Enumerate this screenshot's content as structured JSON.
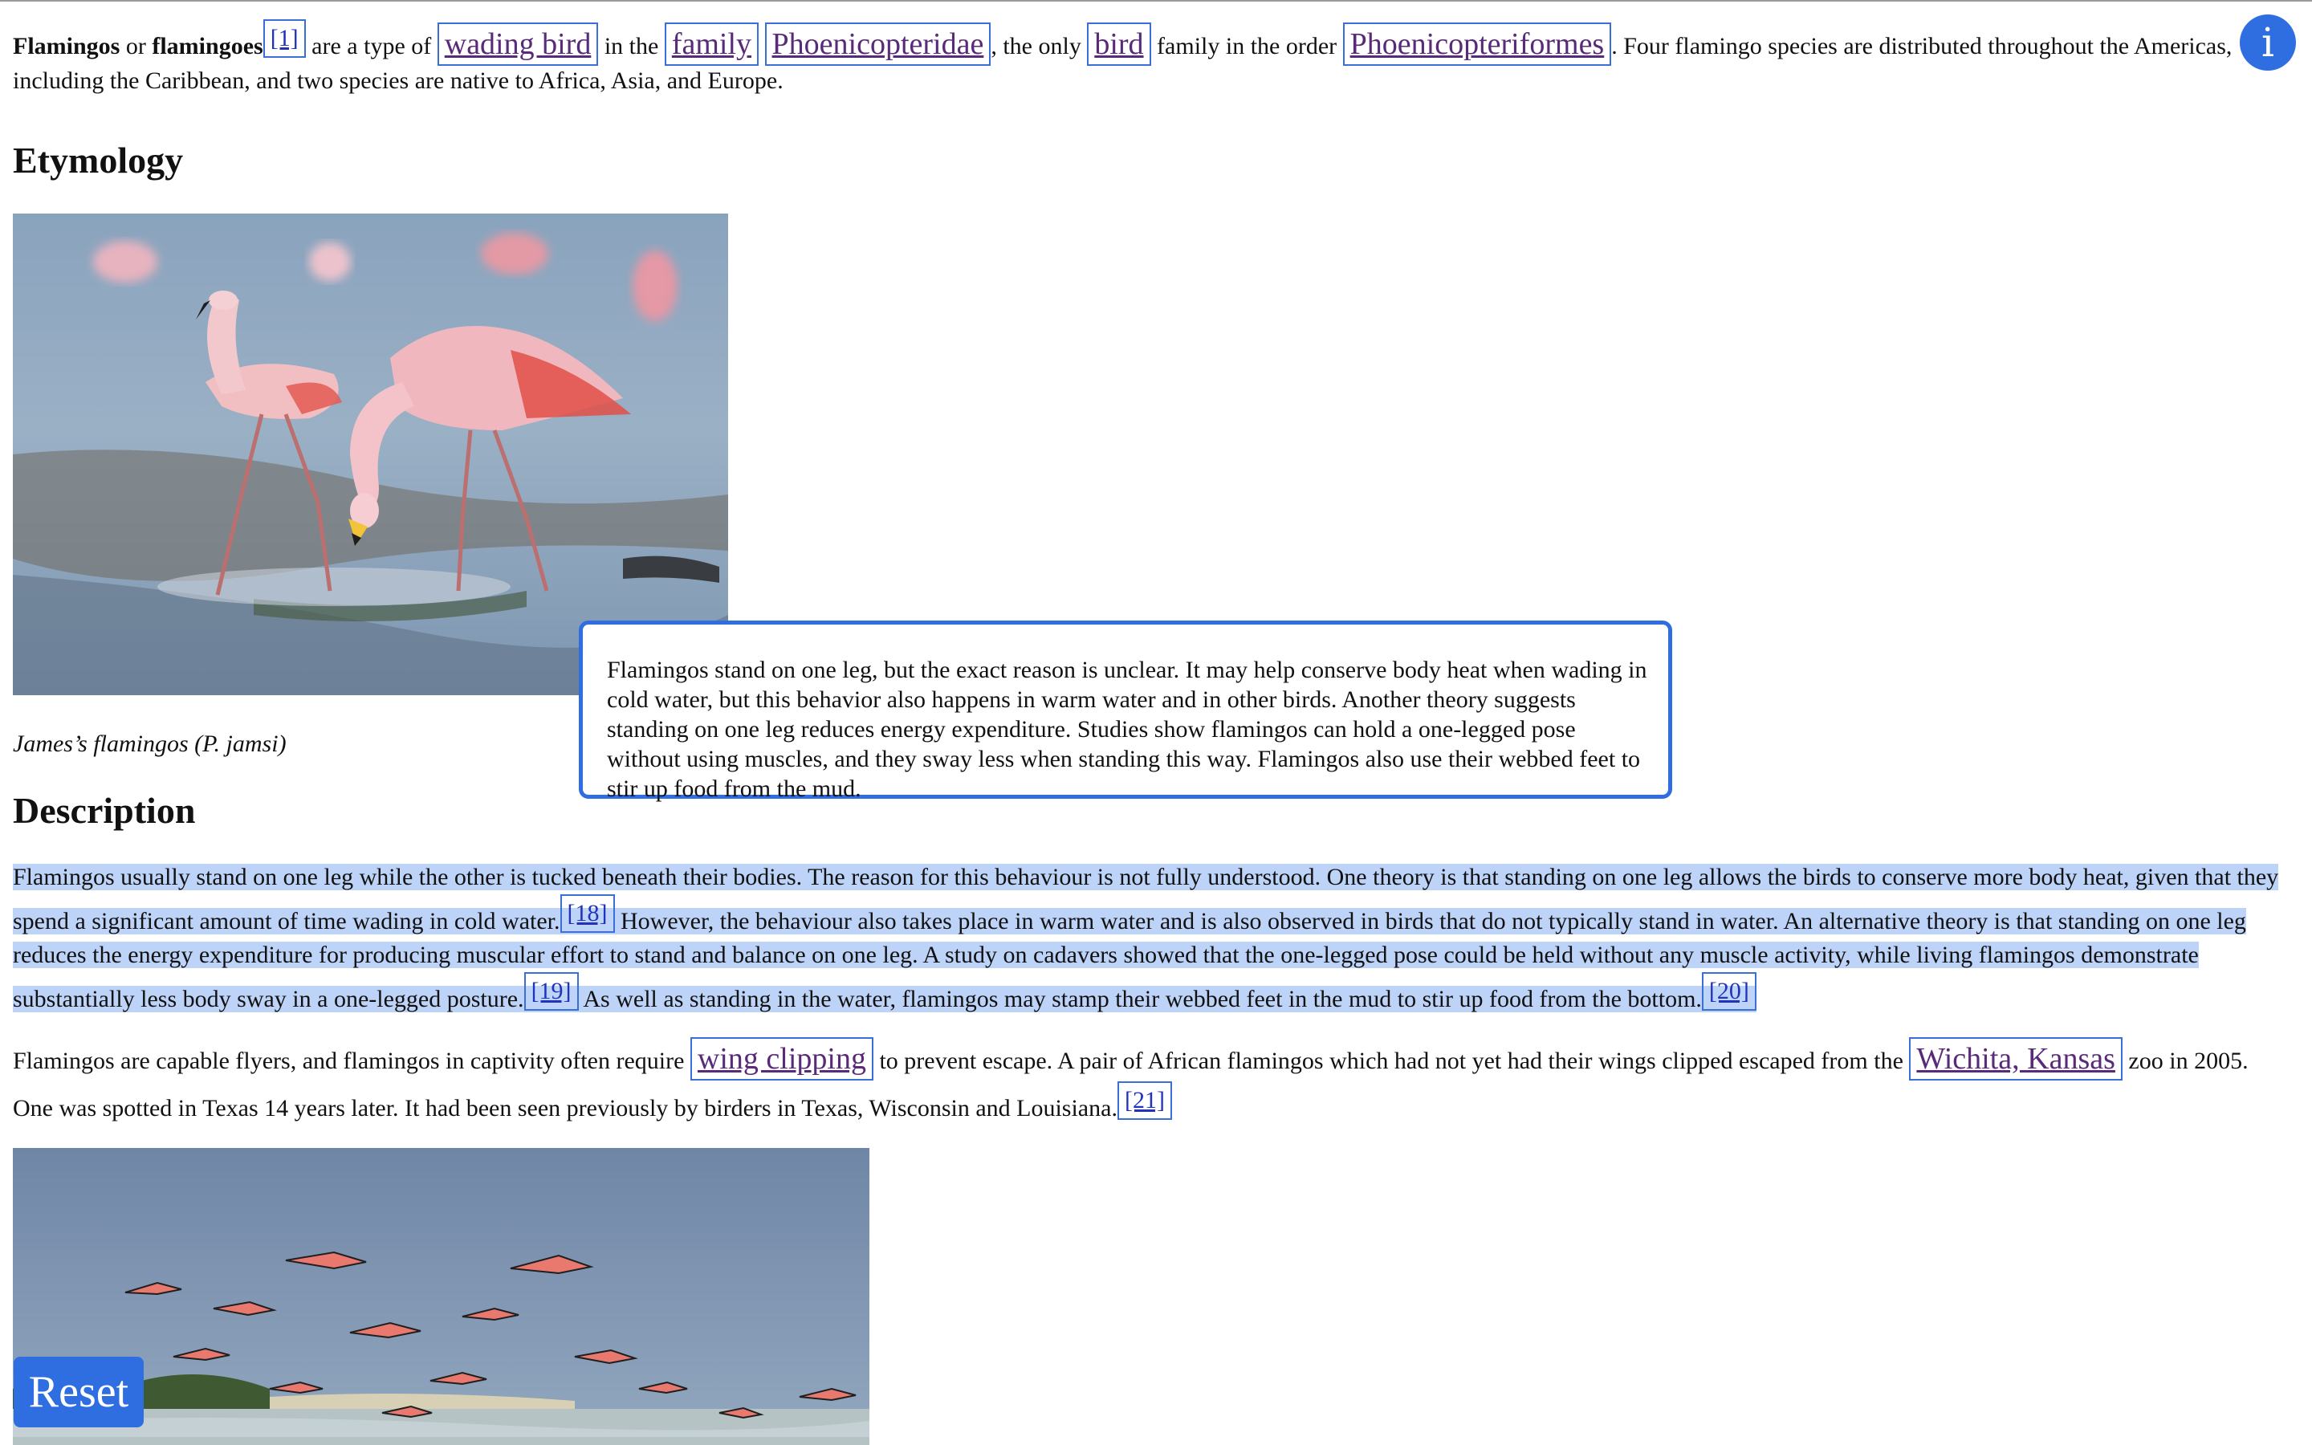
{
  "intro": {
    "term1": "Flamingos",
    "or": " or ",
    "term2": "flamingoes",
    "cite1": "[1]",
    "t1": " are a type of ",
    "link_wading_bird": "wading bird",
    "t2": " in the ",
    "link_family": "family",
    "link_phoenicopteridae": "Phoenicopteridae",
    "t3": ", the only ",
    "link_bird": "bird",
    "t4": " family in the order ",
    "link_phoenicopteriformes": "Phoenicopteriformes",
    "t5": ". Four flamingo species are distributed throughout the Americas, including the Caribbean, and two species are native to Africa, Asia, and Europe."
  },
  "etymology": {
    "heading": "Etymology",
    "caption": "James’s flamingos (P. jamsi)"
  },
  "description": {
    "heading": "Description",
    "p1_a": "Flamingos usually stand on one leg while the other is tucked beneath their bodies. The reason for this behaviour is not fully understood. One theory is that standing on one leg allows the birds to conserve more body heat, given that they spend a significant amount of time wading in cold water.",
    "cite18": "[18]",
    "p1_b": " However, the behaviour also takes place in warm water and is also observed in birds that do not typically stand in water. An alternative theory is that standing on one leg reduces the energy expenditure for producing muscular effort to stand and balance on one leg. A study on cadavers showed that the one-legged pose could be held without any muscle activity, while living flamingos demonstrate substantially less body sway in a one-legged posture.",
    "cite19": "[19]",
    "p1_c": " As well as standing in the water, flamingos may stamp their webbed feet in the mud to stir up food from the bottom.",
    "cite20": "[20]",
    "p2_a": "Flamingos are capable flyers, and flamingos in captivity often require ",
    "link_wing_clipping": "wing clipping",
    "p2_b": " to prevent escape. A pair of African flamingos which had not yet had their wings clipped escaped from the ",
    "link_wichita": "Wichita, Kansas",
    "p2_c": " zoo in 2005. One was spotted in Texas 14 years later. It had been seen previously by birders in Texas, Wisconsin and Louisiana.",
    "cite21": "[21]"
  },
  "tooltip": {
    "text": "Flamingos stand on one leg, but the exact reason is unclear. It may help conserve body heat when wading in cold water, but this behavior also happens in warm water and in other birds. Another theory suggests standing on one leg reduces energy expenditure. Studies show flamingos can hold a one-legged pose without using muscles, and they sway less when standing this way. Flamingos also use their webbed feet to stir up food from the mud."
  },
  "controls": {
    "info_icon": "i",
    "reset_label": "Reset"
  },
  "colors": {
    "accent": "#2f6ee0",
    "highlight": "#bdd3f7",
    "link_visited": "#5a2a7a",
    "link": "#2233bb"
  }
}
